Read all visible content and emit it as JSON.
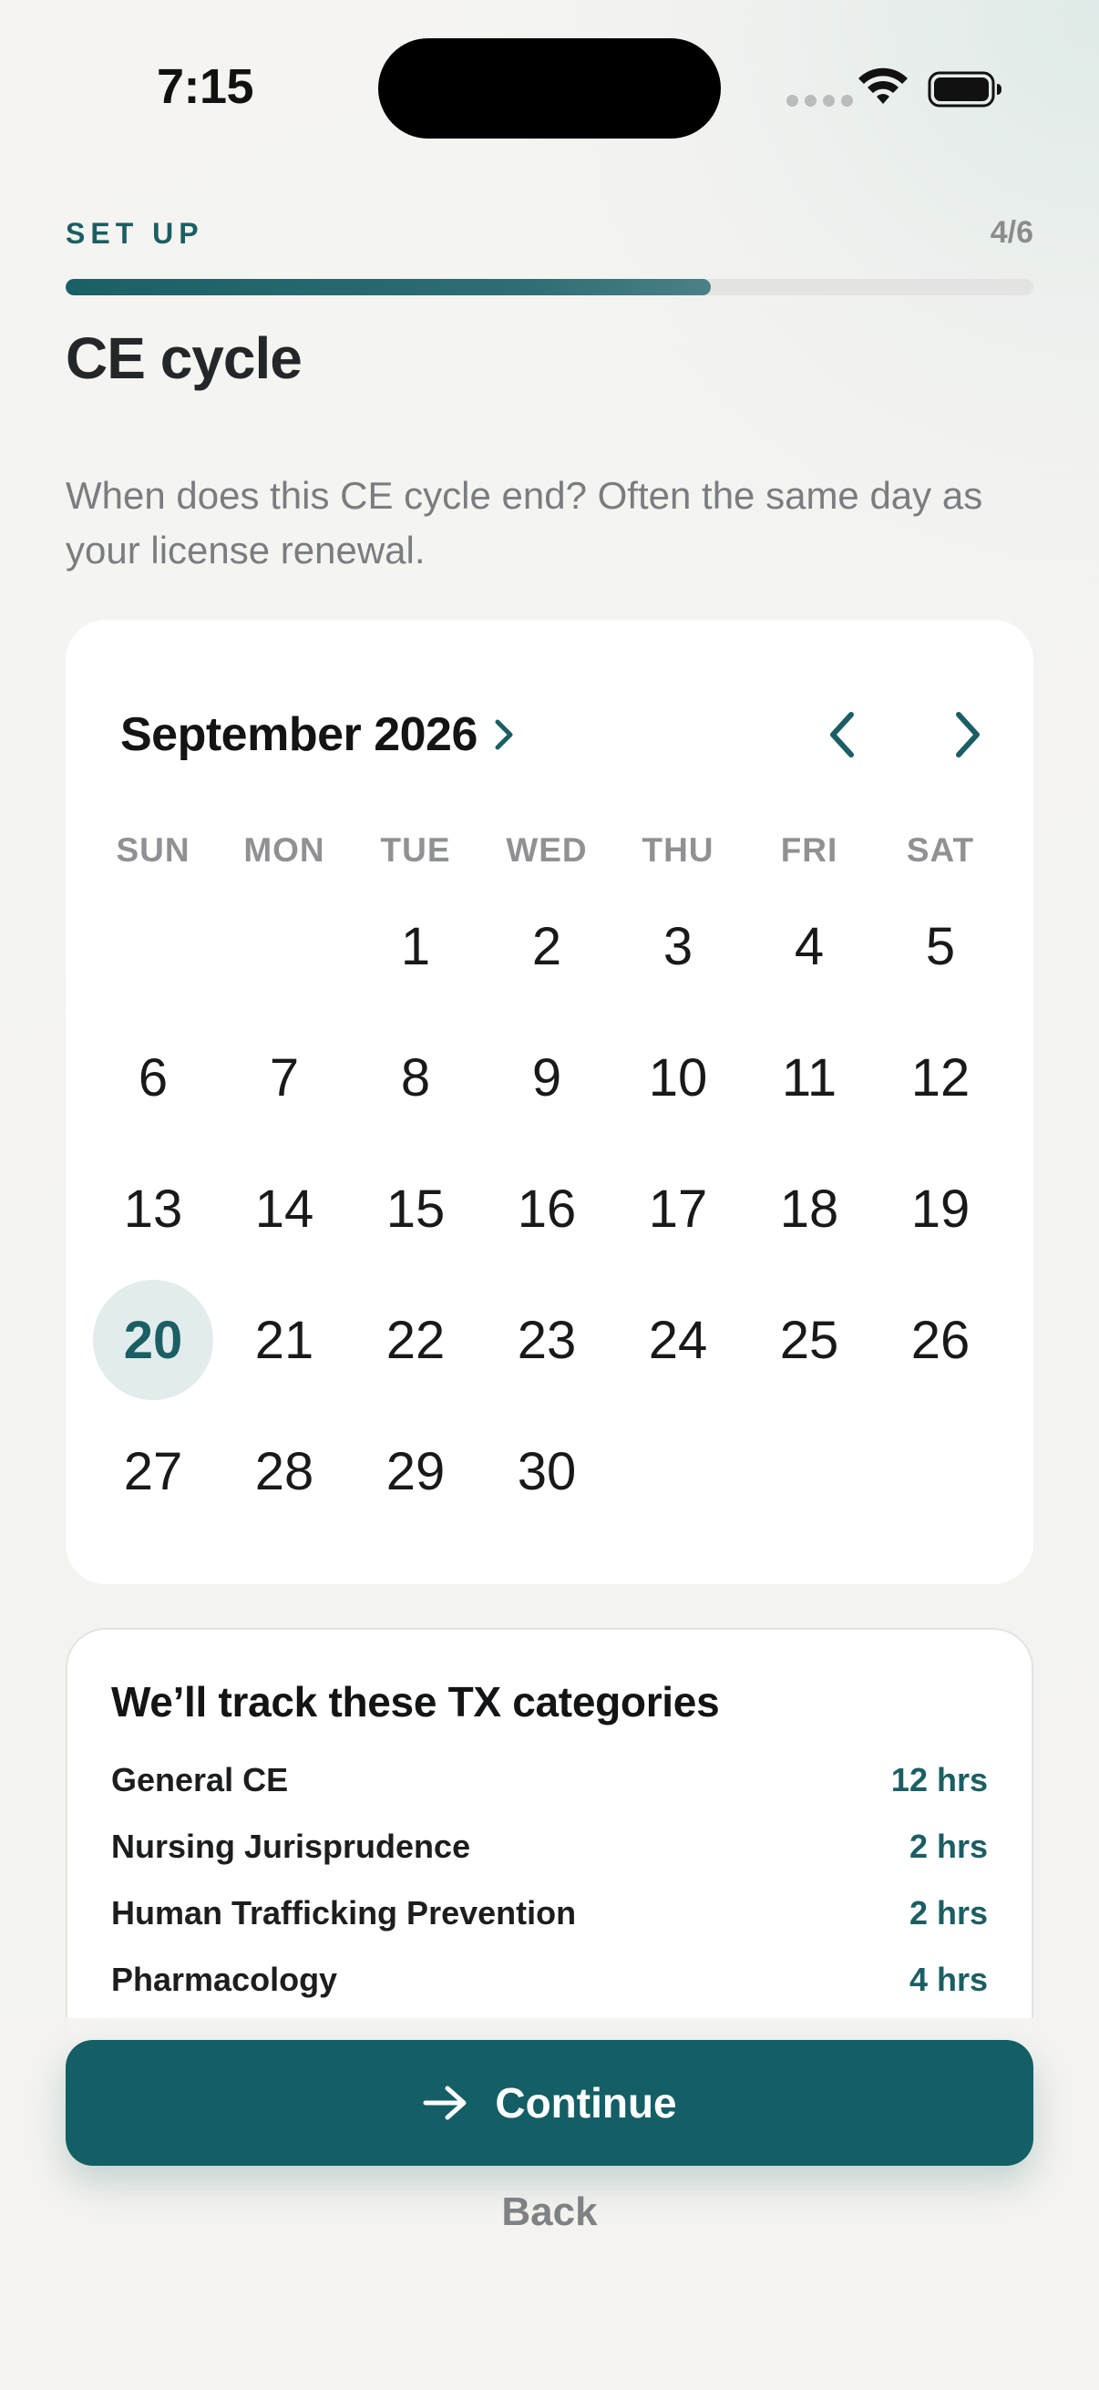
{
  "status_bar": {
    "time": "7:15"
  },
  "header": {
    "step_label": "SET UP",
    "step_count": "4/6",
    "progress_fraction": 0.667,
    "title": "CE cycle",
    "subtitle": "When does this CE cycle end? Often the same day as your license renewal."
  },
  "calendar": {
    "month_label": "September 2026",
    "weekdays": [
      "SUN",
      "MON",
      "TUE",
      "WED",
      "THU",
      "FRI",
      "SAT"
    ],
    "leading_blanks": 2,
    "days_in_month": 30,
    "selected_day": 20,
    "accent_color": "#1b5e63",
    "selected_bg_color": "#e2eced"
  },
  "categories": {
    "title": "We’ll track these TX categories",
    "items": [
      {
        "name": "General CE",
        "hours": "12 hrs"
      },
      {
        "name": "Nursing Jurisprudence",
        "hours": "2 hrs"
      },
      {
        "name": "Human Trafficking Prevention",
        "hours": "2 hrs"
      },
      {
        "name": "Pharmacology",
        "hours": "4 hrs"
      }
    ]
  },
  "actions": {
    "continue_label": "Continue",
    "continue_icon": "arrow-right-icon",
    "back_label": "Back",
    "button_color": "#135f65"
  }
}
